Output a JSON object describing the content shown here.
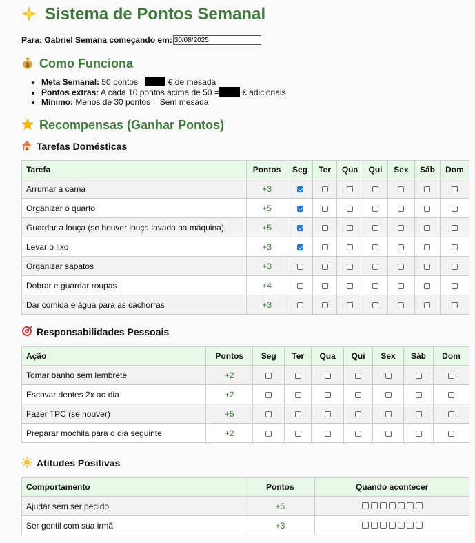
{
  "title": "Sistema de Pontos Semanal",
  "title_icon": "star-icon",
  "params": {
    "label": "Para: Gabriel Semana começando em:",
    "date": "30/08/2025"
  },
  "how": {
    "heading": "Como Funciona",
    "icon": "money-bag-icon",
    "rules": [
      {
        "label": "Meta Semanal:",
        "before": "50 pontos =",
        "after": "€ de mesada"
      },
      {
        "label": "Pontos extras:",
        "before": "A cada 10 pontos acima de 50 =",
        "after": "€ adicionais"
      },
      {
        "label": "Mínimo:",
        "before": "Menos de 30 pontos = Sem mesada",
        "after": ""
      }
    ]
  },
  "rewards": {
    "heading": "Recompensas (Ganhar Pontos)",
    "icon": "star-icon"
  },
  "household": {
    "heading": "Tarefas Domésticas",
    "icon": "house-icon",
    "headers": [
      "Tarefa",
      "Pontos",
      "Seg",
      "Ter",
      "Qua",
      "Qui",
      "Sex",
      "Sáb",
      "Dom"
    ],
    "rows": [
      {
        "task": "Arrumar a cama",
        "points": "+3",
        "checks": [
          true,
          false,
          false,
          false,
          false,
          false,
          false
        ]
      },
      {
        "task": "Organizar o quarto",
        "points": "+5",
        "checks": [
          true,
          false,
          false,
          false,
          false,
          false,
          false
        ]
      },
      {
        "task": "Guardar a louça (se houver louça lavada na máquina)",
        "points": "+5",
        "checks": [
          true,
          false,
          false,
          false,
          false,
          false,
          false
        ]
      },
      {
        "task": "Levar o lixo",
        "points": "+3",
        "checks": [
          true,
          false,
          false,
          false,
          false,
          false,
          false
        ]
      },
      {
        "task": "Organizar sapatos",
        "points": "+3",
        "checks": [
          false,
          false,
          false,
          false,
          false,
          false,
          false
        ]
      },
      {
        "task": "Dobrar e guardar roupas",
        "points": "+4",
        "checks": [
          false,
          false,
          false,
          false,
          false,
          false,
          false
        ]
      },
      {
        "task": "Dar comida e água para as cachorras",
        "points": "+3",
        "checks": [
          false,
          false,
          false,
          false,
          false,
          false,
          false
        ]
      }
    ]
  },
  "personal": {
    "heading": "Responsabilidades Pessoais",
    "icon": "target-icon",
    "headers": [
      "Ação",
      "Pontos",
      "Seg",
      "Ter",
      "Qua",
      "Qui",
      "Sex",
      "Sáb",
      "Dom"
    ],
    "rows": [
      {
        "task": "Tomar banho sem lembrete",
        "points": "+2",
        "checks": [
          false,
          false,
          false,
          false,
          false,
          false,
          false
        ]
      },
      {
        "task": "Escovar dentes 2x ao dia",
        "points": "+2",
        "checks": [
          false,
          false,
          false,
          false,
          false,
          false,
          false
        ]
      },
      {
        "task": "Fazer TPC (se houver)",
        "points": "+5",
        "checks": [
          false,
          false,
          false,
          false,
          false,
          false,
          false
        ]
      },
      {
        "task": "Preparar mochila para o dia seguinte",
        "points": "+2",
        "checks": [
          false,
          false,
          false,
          false,
          false,
          false,
          false
        ]
      }
    ]
  },
  "attitudes": {
    "heading": "Atitudes Positivas",
    "icon": "sun-icon",
    "headers": [
      "Comportamento",
      "Pontos",
      "Quando acontecer"
    ],
    "rows": [
      {
        "task": "Ajudar sem ser pedido",
        "points": "+5",
        "boxes": 7
      },
      {
        "task": "Ser gentil com sua irmã",
        "points": "+3",
        "boxes": 7
      }
    ]
  }
}
